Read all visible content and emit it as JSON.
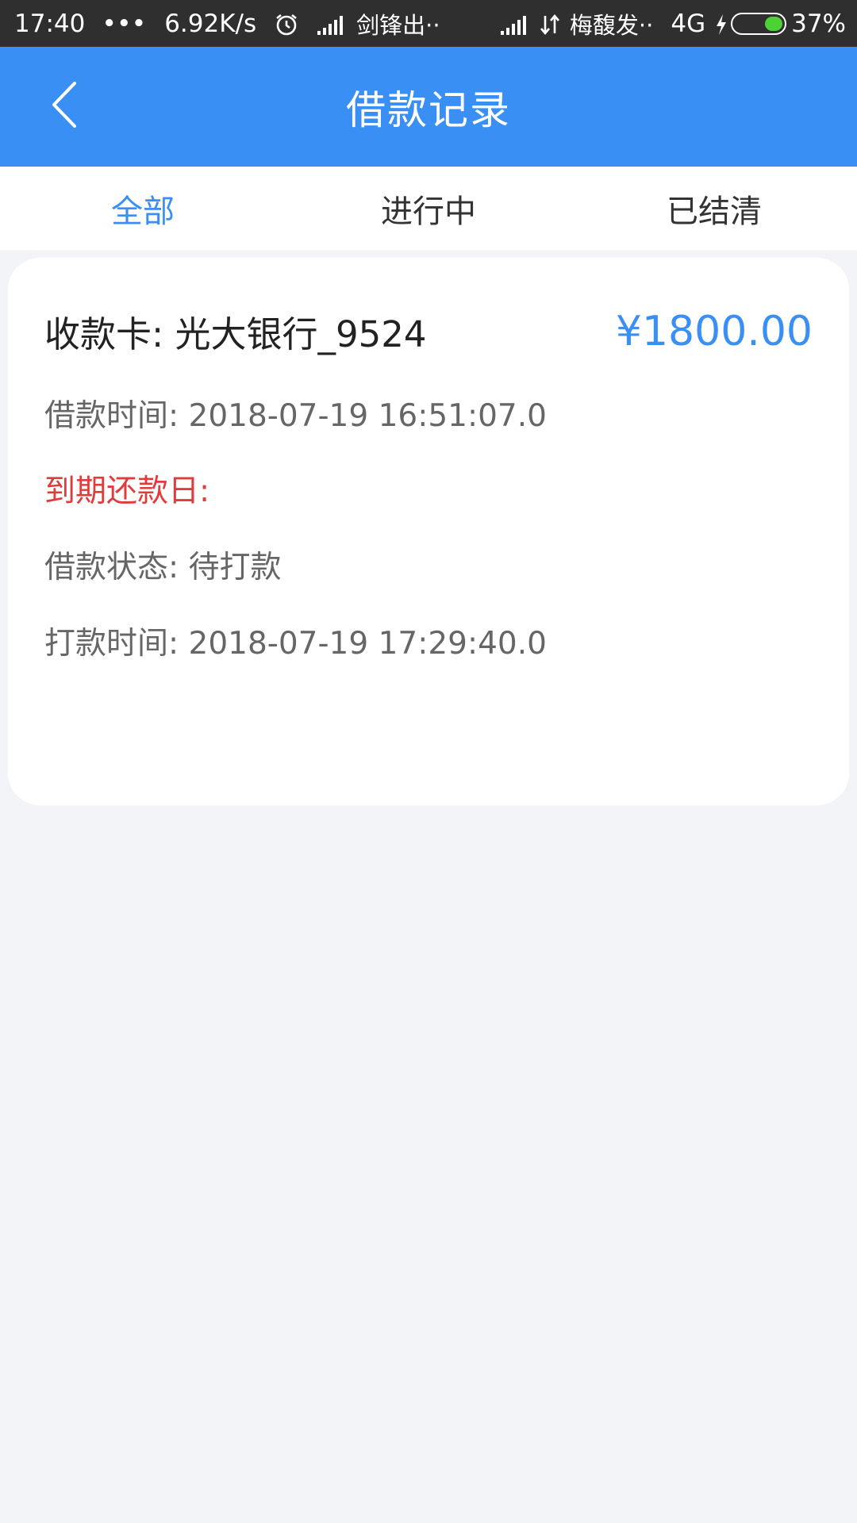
{
  "status_bar": {
    "time": "17:40",
    "dots": "•••",
    "speed": "6.92K/s",
    "carrier1": "剑锋出··",
    "carrier2": "梅馥发··",
    "network": "4G",
    "battery": "37%"
  },
  "header": {
    "title": "借款记录"
  },
  "tabs": [
    {
      "label": "全部",
      "active": true
    },
    {
      "label": "进行中",
      "active": false
    },
    {
      "label": "已结清",
      "active": false
    }
  ],
  "record": {
    "card": "收款卡: 光大银行_9524",
    "amount": "¥1800.00",
    "loan_time": "借款时间: 2018-07-19 16:51:07.0",
    "due_date": "到期还款日:",
    "status": "借款状态: 待打款",
    "payment_time": "打款时间: 2018-07-19 17:29:40.0"
  },
  "colors": {
    "accent": "#3a8ff5",
    "due": "#e23b3b",
    "background": "#f2f4f8"
  }
}
